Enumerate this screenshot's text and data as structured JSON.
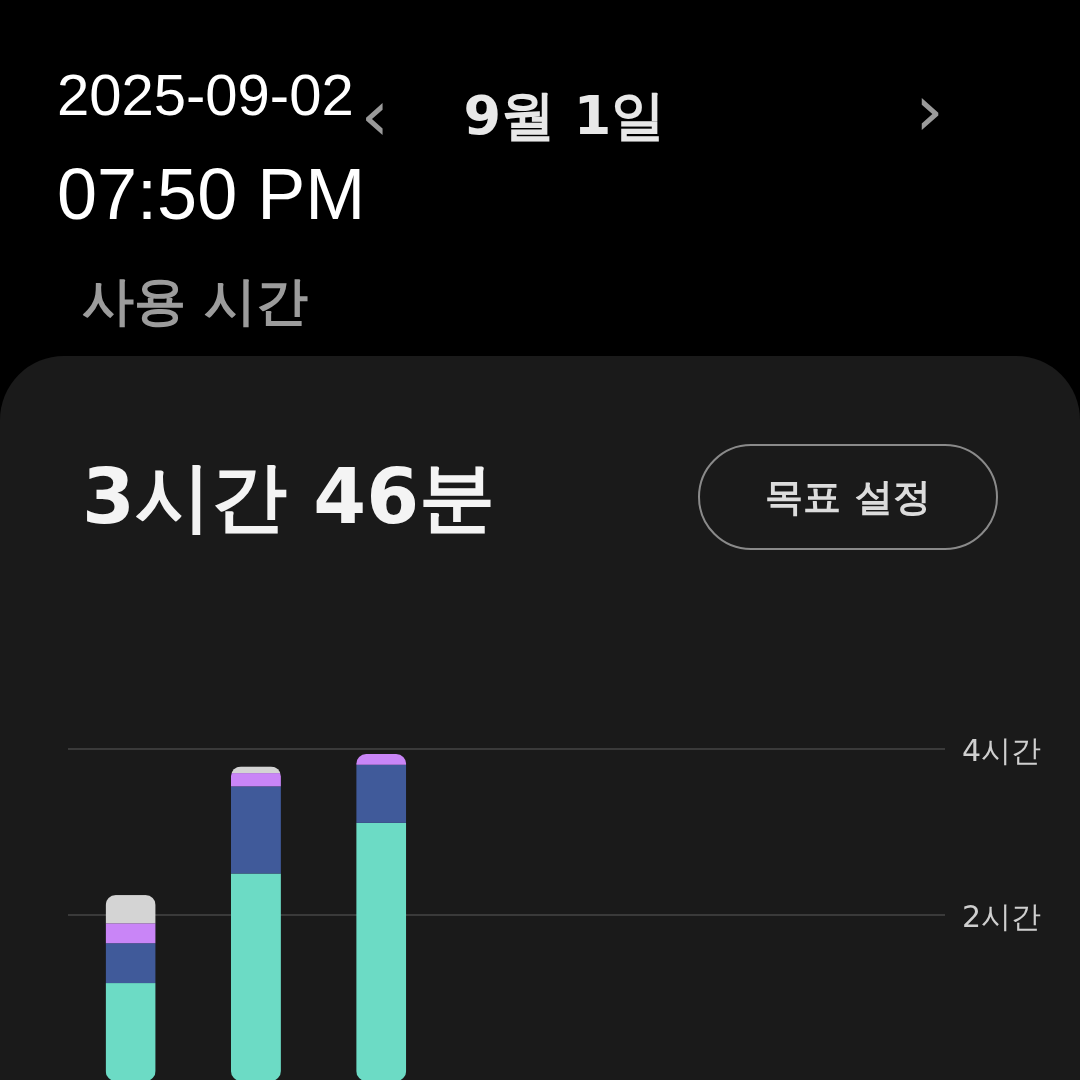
{
  "timestamp_overlay": {
    "date": "2025-09-02",
    "time": "07:50 PM"
  },
  "date_nav": {
    "prev": "‹",
    "label": "9월 1일",
    "next": "›"
  },
  "section_title": "사용 시간",
  "card": {
    "total": "3시간 46분",
    "goal_button": "목표 설정",
    "chart_data": {
      "type": "bar",
      "stacked": true,
      "ylim": [
        0,
        4
      ],
      "yticks": [
        {
          "value": 2,
          "label": "2시간"
        },
        {
          "value": 4,
          "label": "4시간"
        }
      ],
      "series": [
        {
          "color": "#6cdbc5",
          "values": [
            1.18,
            2.5,
            3.11,
            null,
            null,
            null,
            null
          ]
        },
        {
          "color": "#405a9a",
          "values": [
            0.48,
            1.05,
            0.7,
            null,
            null,
            null,
            null
          ]
        },
        {
          "color": "#c985f7",
          "values": [
            0.24,
            0.16,
            0.13,
            null,
            null,
            null,
            null
          ]
        },
        {
          "color": "#d4d4d4",
          "values": [
            0.34,
            0.08,
            null,
            null,
            null,
            null,
            null
          ]
        }
      ]
    }
  }
}
